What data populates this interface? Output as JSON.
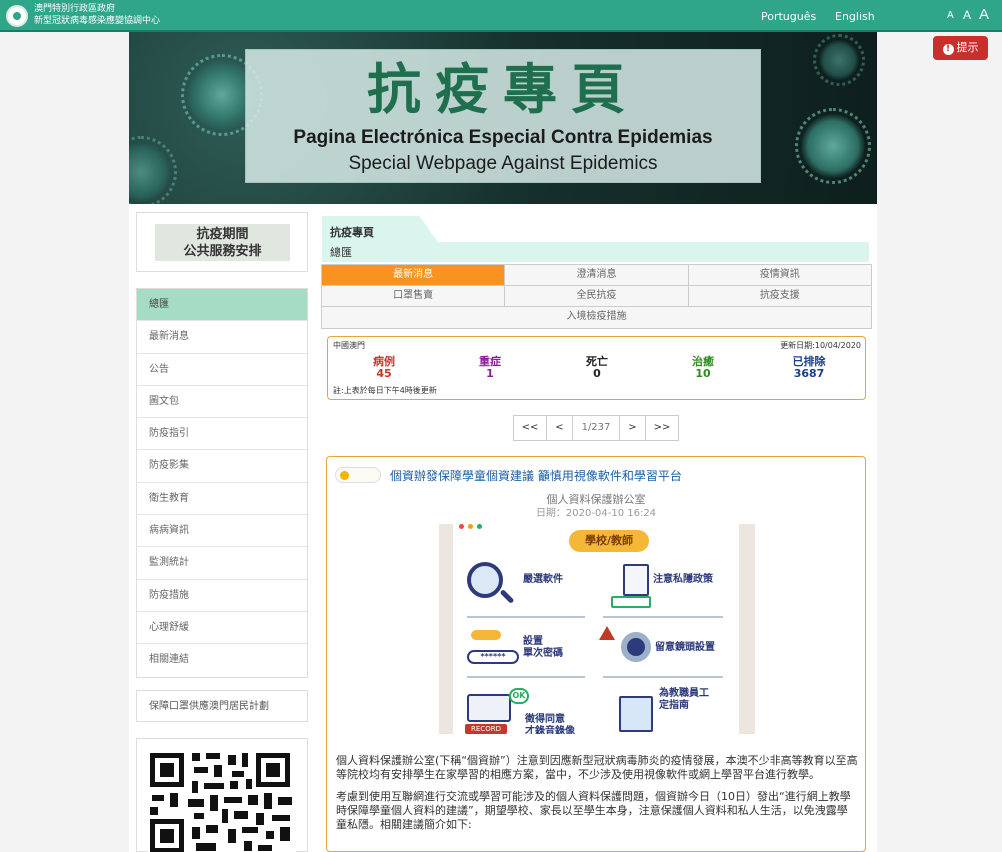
{
  "header": {
    "gov_line1": "澳門特別行政區政府",
    "gov_line2": "新型冠狀病毒感染應變協調中心",
    "lang_pt": "Português",
    "lang_en": "English",
    "font_small": "A",
    "font_medium": "A",
    "font_large": "A"
  },
  "notice_button": {
    "label": "提示"
  },
  "banner": {
    "title_zh": "抗疫專頁",
    "title_pt": "Pagina Electrónica Especial Contra Epidemias",
    "title_en": "Special Webpage Against Epidemics"
  },
  "sidebar": {
    "public_services_line1": "抗疫期間",
    "public_services_line2": "公共服務安排",
    "items": [
      {
        "label": "總匯",
        "active": true
      },
      {
        "label": "最新消息"
      },
      {
        "label": "公告"
      },
      {
        "label": "圖文包"
      },
      {
        "label": "防疫指引"
      },
      {
        "label": "防疫影集"
      },
      {
        "label": "衛生教育"
      },
      {
        "label": "病病資訊"
      },
      {
        "label": "監測統計"
      },
      {
        "label": "防疫措施"
      },
      {
        "label": "心理舒緩"
      },
      {
        "label": "相關連結"
      }
    ],
    "mask_plan": "保障口罩供應澳門居民計劃"
  },
  "breadcrumb": {
    "tab": "抗疫專頁",
    "sub": "總匯"
  },
  "tabs": {
    "row1": [
      "最新消息",
      "澄清消息",
      "疫情資訊"
    ],
    "row2": [
      "口罩售賣",
      "全民抗疫",
      "抗疫支援"
    ],
    "row3": [
      "入境檢疫措施"
    ]
  },
  "stats": {
    "region": "中國澳門",
    "updated": "更新日期:10/04/2020",
    "items": [
      {
        "label": "病例",
        "value": "45",
        "color": "#c0392b"
      },
      {
        "label": "重症",
        "value": "1",
        "color": "#8e1b9a"
      },
      {
        "label": "死亡",
        "value": "0",
        "color": "#222222"
      },
      {
        "label": "治癒",
        "value": "10",
        "color": "#2e8b1f"
      },
      {
        "label": "已排除",
        "value": "3687",
        "color": "#1b3f8b"
      }
    ],
    "note": "註:上表於每日下午4時後更新"
  },
  "pager": {
    "first": "<<",
    "prev": "<",
    "page": "1/237",
    "next": ">",
    "last": ">>"
  },
  "article": {
    "title": "個資辦發保障學童個資建議 籲慎用視像軟件和學習平台",
    "source": "個人資料保護辦公室",
    "date": "日期：2020-04-10 16:24",
    "poster": {
      "header": "學校/教師",
      "item1": "嚴選軟件",
      "item2": "注意私隱政策",
      "item3a": "設置",
      "item3b": "單次密碼",
      "item4": "留意鏡頭設置",
      "item5a": "徵得同意",
      "item5b": "才錄音錄像",
      "item6a": "為教職員工",
      "item6b": "定指南",
      "record": "RECORD",
      "ok": "OK",
      "password_mask": "******"
    },
    "para1": "個人資料保護辦公室(下稱“個資辦”）注意到因應新型冠狀病毒肺炎的疫情發展，本澳不少非高等教育以至高等院校均有安排學生在家學習的相應方案，當中，不少涉及使用視像軟件或網上學習平台進行教學。",
    "para2": "考慮到使用互聯網進行交流或學習可能涉及的個人資料保護問題，個資辦今日（10日）發出“進行網上教學時保障學童個人資料的建議”，期望學校、家長以至學生本身，注意保護個人資料和私人生活，以免洩露學童私隱。相關建議簡介如下:"
  }
}
